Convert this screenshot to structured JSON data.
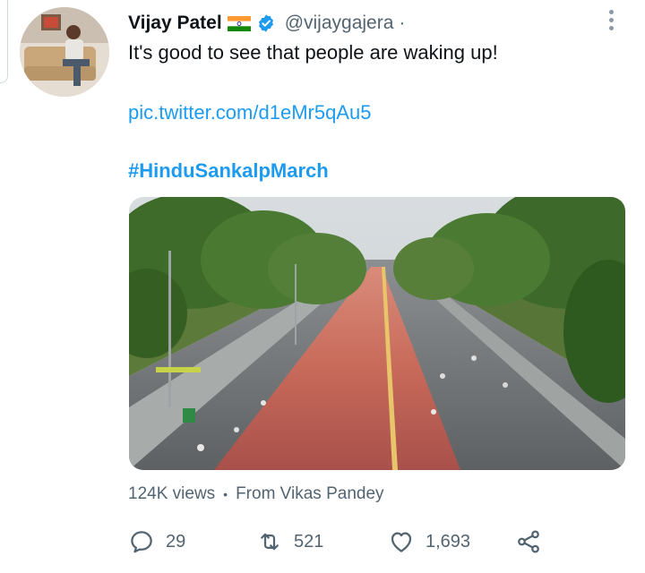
{
  "tweet": {
    "display_name": "Vijay Patel",
    "handle": "@vijaygajera",
    "separator": "·",
    "text": "It's good to see that people are waking up!",
    "link": "pic.twitter.com/d1eMr5qAu5",
    "hashtag": "#HinduSankalpMarch"
  },
  "media": {
    "views": "124K views",
    "separator": "•",
    "from": "From Vikas Pandey"
  },
  "actions": {
    "replies": "29",
    "retweets": "521",
    "likes": "1,693"
  },
  "icons": {
    "verified": "verified-badge-icon",
    "flag": "india-flag-icon",
    "more": "more-options-icon",
    "reply": "reply-icon",
    "retweet": "retweet-icon",
    "like": "heart-icon",
    "share": "share-icon"
  },
  "colors": {
    "link": "#1d9bf0",
    "secondary_text": "#536471",
    "verified": "#1d9bf0"
  }
}
